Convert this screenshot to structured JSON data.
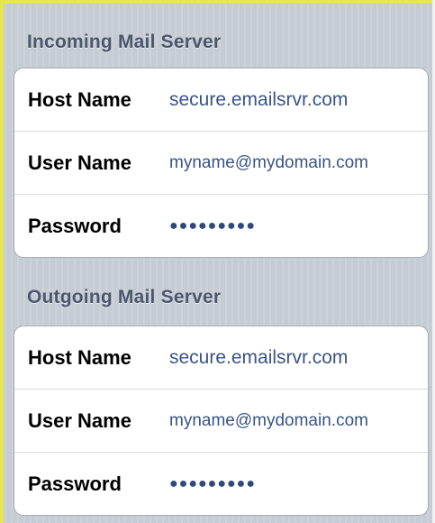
{
  "incoming": {
    "header": "Incoming Mail Server",
    "host_name": {
      "label": "Host Name",
      "value": "secure.emailsrvr.com"
    },
    "user_name": {
      "label": "User Name",
      "value": "myname@mydomain.com"
    },
    "password": {
      "label": "Password",
      "value": "●●●●●●●●●"
    }
  },
  "outgoing": {
    "header": "Outgoing Mail Server",
    "host_name": {
      "label": "Host Name",
      "value": "secure.emailsrvr.com"
    },
    "user_name": {
      "label": "User Name",
      "value": "myname@mydomain.com"
    },
    "password": {
      "label": "Password",
      "value": "●●●●●●●●●"
    }
  },
  "colors": {
    "background": "#c5ccd4",
    "header_text": "#4c566c",
    "value_text": "#385487",
    "frame_accent": "#e7e64d"
  }
}
